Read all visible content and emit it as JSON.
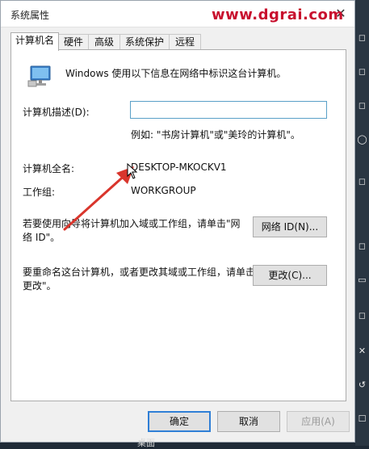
{
  "window": {
    "title": "系统属性",
    "close_glyph": "✕"
  },
  "watermark": "www.dgrai.com",
  "tabs": [
    {
      "label": "计算机名",
      "active": true
    },
    {
      "label": "硬件",
      "active": false
    },
    {
      "label": "高级",
      "active": false
    },
    {
      "label": "系统保护",
      "active": false
    },
    {
      "label": "远程",
      "active": false
    }
  ],
  "panel": {
    "intro": "Windows 使用以下信息在网络中标识这台计算机。",
    "description_label": "计算机描述(D):",
    "description_value": "",
    "description_example": "例如: \"书房计算机\"或\"美玲的计算机\"。",
    "full_name_label": "计算机全名:",
    "full_name_value": "DESKTOP-MKOCKV1",
    "workgroup_label": "工作组:",
    "workgroup_value": "WORKGROUP",
    "network_id_text_line1": "若要使用向导将计算机加入域或工作组，请单击\"网",
    "network_id_text_line2": "络 ID\"。",
    "network_id_button": "网络 ID(N)...",
    "rename_text_line1": "要重命名这台计算机，或者更改其域或工作组，请单击\"",
    "rename_text_line2": "更改\"。",
    "change_button": "更改(C)..."
  },
  "footer": {
    "ok": "确定",
    "cancel": "取消",
    "apply": "应用(A)"
  },
  "background": {
    "bottom_item": "桌面"
  },
  "colors": {
    "accent": "#2f7fd6",
    "annotation_arrow": "#d9352c",
    "watermark": "#c8102e"
  }
}
